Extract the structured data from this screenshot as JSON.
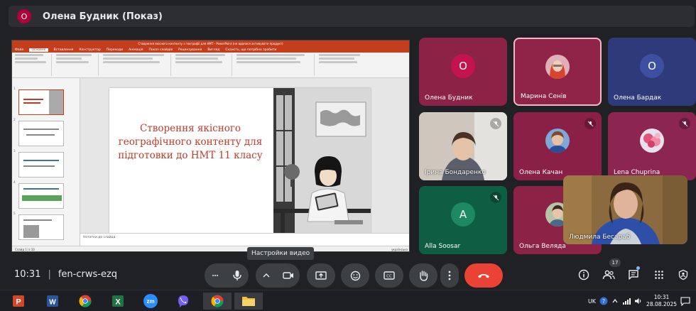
{
  "presenter": {
    "initial": "О",
    "label": "Олена Будник (Показ)"
  },
  "presentation": {
    "window_title": "Створення якісного контенту з географії для НМТ - PowerPoint (не вдалося активувати продукт)",
    "tabs": [
      "Файл",
      "Основне",
      "Вставлення",
      "Конструктор",
      "Переходи",
      "Анімація",
      "Показ слайдів",
      "Рецензування",
      "Вигляд",
      "Скажіть, що потрібно зробити"
    ],
    "active_tab": "Основне",
    "slide_title": "Створення якісного географічного контенту для підготовки до НМТ 11 класу",
    "notes_placeholder": "Нотатки до слайда",
    "status_left": "Слайд 1 із 10",
    "status_lang": "українська",
    "thumb_numbers": [
      "1",
      "2",
      "3",
      "4",
      "5"
    ],
    "colors": {
      "ribbon": "#c43e1c",
      "title_text": "#c0392b"
    }
  },
  "participants": [
    {
      "name": "Олена Будник",
      "initial": "О",
      "bg": "#8c2246",
      "avatar_bg": "#c4134f",
      "muted": false,
      "kind": "initial"
    },
    {
      "name": "Марина Сенів",
      "bg": "#8f2448",
      "muted": false,
      "kind": "photo",
      "active": true
    },
    {
      "name": "Олена Бардак",
      "initial": "О",
      "bg": "#2f3a7a",
      "avatar_bg": "#3d4fa0",
      "muted": false,
      "kind": "initial"
    },
    {
      "name": "Ірина Бондаренко",
      "bg": "#c8c0b8",
      "muted": true,
      "kind": "video"
    },
    {
      "name": "Олена Качан",
      "bg": "#8a2046",
      "muted": true,
      "kind": "photo"
    },
    {
      "name": "Lena Chuprina",
      "bg": "#8c2550",
      "muted": true,
      "kind": "photo"
    },
    {
      "name": "Alla Soosar",
      "initial": "A",
      "bg": "#0e5e43",
      "avatar_bg": "#1e8a63",
      "muted": true,
      "kind": "initial"
    },
    {
      "name": "Ольга Веляда",
      "bg": "#8c2246",
      "muted": true,
      "kind": "photo"
    },
    {
      "name": "Людмила Бесараб",
      "kind": "self"
    }
  ],
  "tooltip": "Настройки видео",
  "meeting": {
    "time": "10:31",
    "code": "fen-crws-ezq",
    "people_count": "17"
  },
  "taskbar": {
    "language": "UK",
    "time": "10:31",
    "date": "28.08.2025"
  }
}
